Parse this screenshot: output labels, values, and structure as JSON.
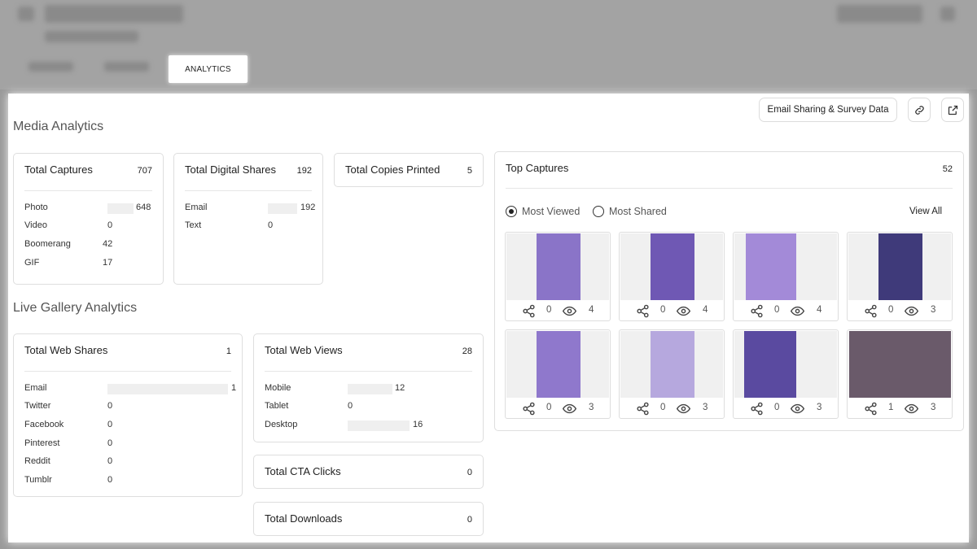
{
  "tabs": {
    "analytics": "ANALYTICS"
  },
  "toolbar": {
    "email_sharing_label": "Email Sharing & Survey Data"
  },
  "media_analytics": {
    "title": "Media Analytics",
    "total_captures": {
      "title": "Total Captures",
      "total": "707",
      "rows": [
        {
          "label": "Photo",
          "value": "648"
        },
        {
          "label": "Video",
          "value": "0"
        },
        {
          "label": "Boomerang",
          "value": "42"
        },
        {
          "label": "GIF",
          "value": "17"
        }
      ]
    },
    "total_digital_shares": {
      "title": "Total Digital Shares",
      "total": "192",
      "rows": [
        {
          "label": "Email",
          "value": "192"
        },
        {
          "label": "Text",
          "value": "0"
        }
      ]
    },
    "total_copies_printed": {
      "title": "Total Copies Printed",
      "total": "5"
    }
  },
  "live_gallery": {
    "title": "Live Gallery Analytics",
    "total_web_shares": {
      "title": "Total Web Shares",
      "total": "1",
      "rows": [
        {
          "label": "Email",
          "value": "1"
        },
        {
          "label": "Twitter",
          "value": "0"
        },
        {
          "label": "Facebook",
          "value": "0"
        },
        {
          "label": "Pinterest",
          "value": "0"
        },
        {
          "label": "Reddit",
          "value": "0"
        },
        {
          "label": "Tumblr",
          "value": "0"
        }
      ]
    },
    "total_web_views": {
      "title": "Total Web Views",
      "total": "28",
      "rows": [
        {
          "label": "Mobile",
          "value": "12"
        },
        {
          "label": "Tablet",
          "value": "0"
        },
        {
          "label": "Desktop",
          "value": "16"
        }
      ]
    },
    "total_cta_clicks": {
      "title": "Total CTA Clicks",
      "total": "0"
    },
    "total_downloads": {
      "title": "Total Downloads",
      "total": "0"
    }
  },
  "top_captures": {
    "title": "Top Captures",
    "total": "52",
    "filter_most_viewed": "Most Viewed",
    "filter_most_shared": "Most Shared",
    "selected_filter": "Most Viewed",
    "view_all": "View All",
    "items": [
      {
        "shares": "0",
        "views": "4"
      },
      {
        "shares": "0",
        "views": "4"
      },
      {
        "shares": "0",
        "views": "4"
      },
      {
        "shares": "0",
        "views": "3"
      },
      {
        "shares": "0",
        "views": "3"
      },
      {
        "shares": "0",
        "views": "3"
      },
      {
        "shares": "0",
        "views": "3"
      },
      {
        "shares": "1",
        "views": "3"
      }
    ]
  },
  "colors": {
    "accent_purple": "#7c5fc4",
    "photo_bg": "#9a86d6",
    "card_border": "#dedede"
  }
}
